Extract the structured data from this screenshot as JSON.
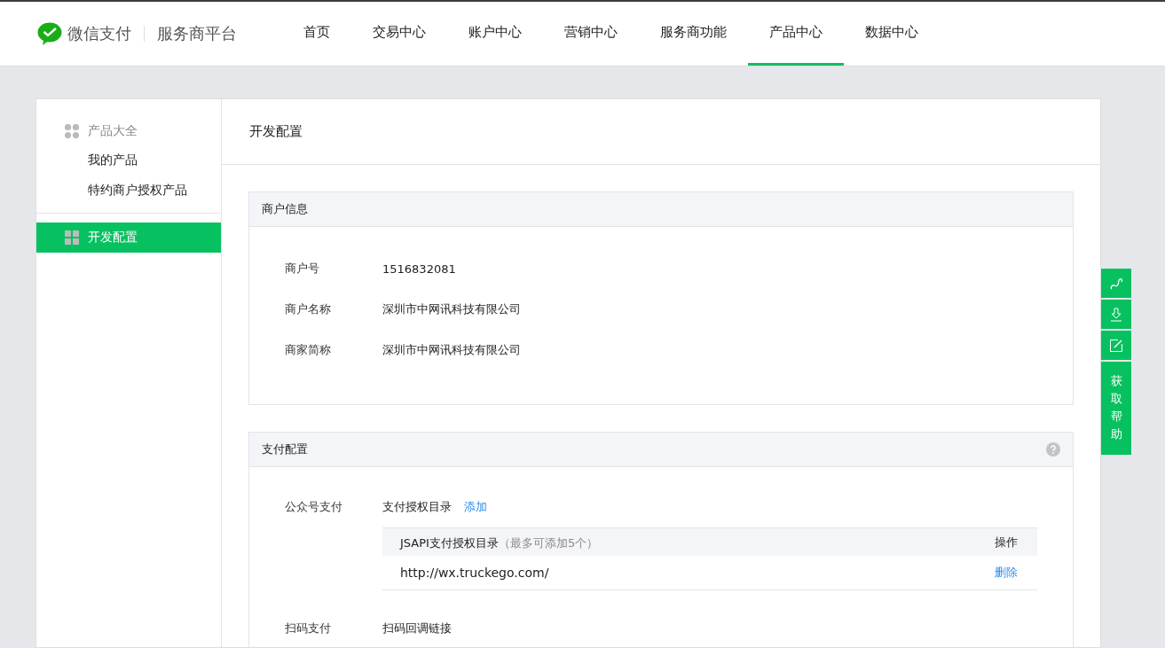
{
  "header": {
    "brand": "微信支付",
    "platform": "服务商平台",
    "nav": [
      {
        "label": "首页",
        "selected": false
      },
      {
        "label": "交易中心",
        "selected": false
      },
      {
        "label": "账户中心",
        "selected": false
      },
      {
        "label": "营销中心",
        "selected": false
      },
      {
        "label": "服务商功能",
        "selected": false
      },
      {
        "label": "产品中心",
        "selected": true
      },
      {
        "label": "数据中心",
        "selected": false
      }
    ]
  },
  "sidebar": {
    "group": "产品大全",
    "items": [
      {
        "label": "我的产品",
        "selected": false
      },
      {
        "label": "特约商户授权产品",
        "selected": false
      }
    ],
    "active": {
      "label": "开发配置",
      "selected": true
    }
  },
  "page_title": "开发配置",
  "merchant_info": {
    "title": "商户信息",
    "fields": [
      {
        "label": "商户号",
        "value": "1516832081"
      },
      {
        "label": "商户名称",
        "value": "深圳市中网讯科技有限公司"
      },
      {
        "label": "商家简称",
        "value": "深圳市中网讯科技有限公司"
      }
    ]
  },
  "payment_config": {
    "title": "支付配置",
    "sections": [
      {
        "label": "公众号支付",
        "subtitle": "支付授权目录",
        "action": "添加",
        "table": {
          "heading": "JSAPI支付授权目录",
          "hint": "（最多可添加5个）",
          "op_heading": "操作",
          "rows": [
            {
              "url": "http://wx.truckego.com/",
              "op": "删除"
            }
          ]
        }
      },
      {
        "label": "扫码支付",
        "subtitle": "扫码回调链接"
      }
    ]
  },
  "float_bar": {
    "help": "获取帮助"
  }
}
